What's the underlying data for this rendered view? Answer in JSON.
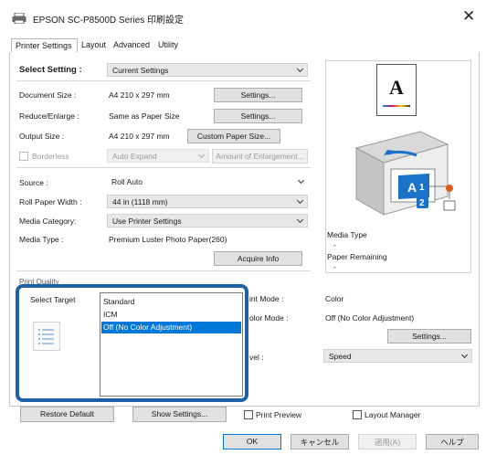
{
  "window": {
    "title": "EPSON SC-P8500D Series 印刷設定",
    "close_label": "✕"
  },
  "tabs": [
    {
      "label": "Printer Settings"
    },
    {
      "label": "Layout"
    },
    {
      "label": "Advanced"
    },
    {
      "label": "Utility"
    }
  ],
  "select_setting": {
    "label": "Select Setting :",
    "value": "Current Settings"
  },
  "document_size": {
    "label": "Document Size :",
    "value": "A4 210 x 297 mm",
    "button": "Settings..."
  },
  "reduce_enlarge": {
    "label": "Reduce/Enlarge :",
    "value": "Same as Paper Size",
    "button": "Settings..."
  },
  "output_size": {
    "label": "Output Size :",
    "value": "A4 210 x 297 mm",
    "button": "Custom Paper Size..."
  },
  "borderless": {
    "label": "Borderless",
    "combo": "Auto Expand",
    "button": "Amount of Enlargement..."
  },
  "source": {
    "label": "Source :",
    "value": "Roll Auto"
  },
  "roll_paper_width": {
    "label": "Roll Paper Width :",
    "value": "44 in (1118 mm)"
  },
  "media_category": {
    "label": "Media Category:",
    "value": "Use Printer Settings"
  },
  "media_type": {
    "label": "Media Type :",
    "value": "Premium Luster Photo Paper(260)",
    "button": "Acquire Info"
  },
  "preview": {
    "paper_letter": "A",
    "media_type_label": "Media Type",
    "media_type_value": "-",
    "paper_remaining_label": "Paper Remaining",
    "paper_remaining_value": "-",
    "roll1": "1",
    "roll2": "2"
  },
  "print_quality": {
    "group_label": "Print Quality",
    "select_target_label": "Select Target",
    "targets": [
      {
        "label": "Standard",
        "selected": false
      },
      {
        "label": "ICM",
        "selected": false
      },
      {
        "label": "Off (No Color Adjustment)",
        "selected": true
      }
    ],
    "print_mode_label": "int Mode :",
    "print_mode_value": "Color",
    "color_mode_label": "olor Mode :",
    "color_mode_value": "Off (No Color Adjustment)",
    "settings_button": "Settings...",
    "level_label": "vel :",
    "level_value": "Speed"
  },
  "footer": {
    "restore_default": "Restore Default",
    "show_settings": "Show Settings...",
    "print_preview": "Print Preview",
    "layout_manager": "Layout Manager"
  },
  "dialog_buttons": {
    "ok": "OK",
    "cancel": "キャンセル",
    "apply": "適用(A)",
    "help": "ヘルプ"
  },
  "colors": {
    "highlight_border": "#1f61a8",
    "selection": "#0078d7",
    "printer_accent": "#1a73c8"
  }
}
